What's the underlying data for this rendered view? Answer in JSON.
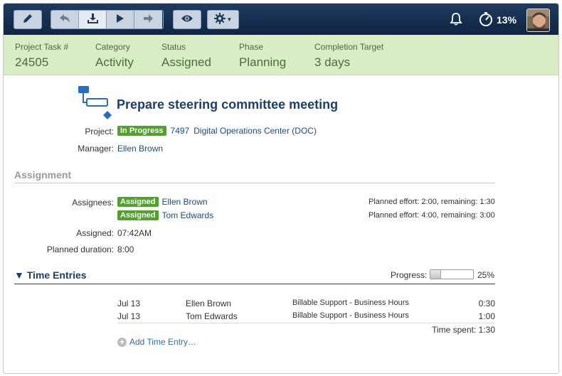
{
  "toolbar": {
    "buttons": [
      "edit-icon",
      "back-icon",
      "save-icon",
      "play-icon",
      "forward-icon",
      "eye-icon",
      "gear-icon"
    ],
    "notification_icon": "bell-icon",
    "timer_percent": "13%"
  },
  "summary": {
    "project_task": {
      "label": "Project Task #",
      "value": "24505"
    },
    "category": {
      "label": "Category",
      "value": "Activity"
    },
    "status": {
      "label": "Status",
      "value": "Assigned"
    },
    "phase": {
      "label": "Phase",
      "value": "Planning"
    },
    "completion_target": {
      "label": "Completion Target",
      "value": "3 days"
    }
  },
  "task": {
    "title": "Prepare steering committee meeting",
    "project_label": "Project:",
    "project_status": "In Progress",
    "project_number": "7497",
    "project_name": "Digital Operations Center (DOC)",
    "manager_label": "Manager:",
    "manager": "Ellen Brown"
  },
  "assignment": {
    "heading": "Assignment",
    "assignees_label": "Assignees:",
    "assignees": [
      {
        "status": "Assigned",
        "name": "Ellen Brown",
        "effort": "Planned effort: 2:00, remaining: 1:30"
      },
      {
        "status": "Assigned",
        "name": "Tom Edwards",
        "effort": "Planned effort: 4:00, remaining: 3:00"
      }
    ],
    "assigned_label": "Assigned:",
    "assigned_value": "07:42AM",
    "duration_label": "Planned duration:",
    "duration_value": "8:00"
  },
  "time_entries": {
    "heading": "Time Entries",
    "toggle": "▼",
    "progress_label": "Progress:",
    "progress_fraction": 0.25,
    "progress_text": "25%",
    "rows": [
      {
        "date": "Jul 13",
        "person": "Ellen Brown",
        "type": "Billable Support - Business Hours",
        "hours": "0:30"
      },
      {
        "date": "Jul 13",
        "person": "Tom Edwards",
        "type": "Billable Support - Business Hours",
        "hours": "1:00"
      }
    ],
    "time_spent": "Time spent: 1:30",
    "add_label": "Add Time Entry…"
  },
  "colors": {
    "header_bg": "#0f2542",
    "summary_bg": "#d8ecc6",
    "title": "#1a3e7a",
    "badge": "#4ea32a",
    "link": "#1a4a8c"
  }
}
